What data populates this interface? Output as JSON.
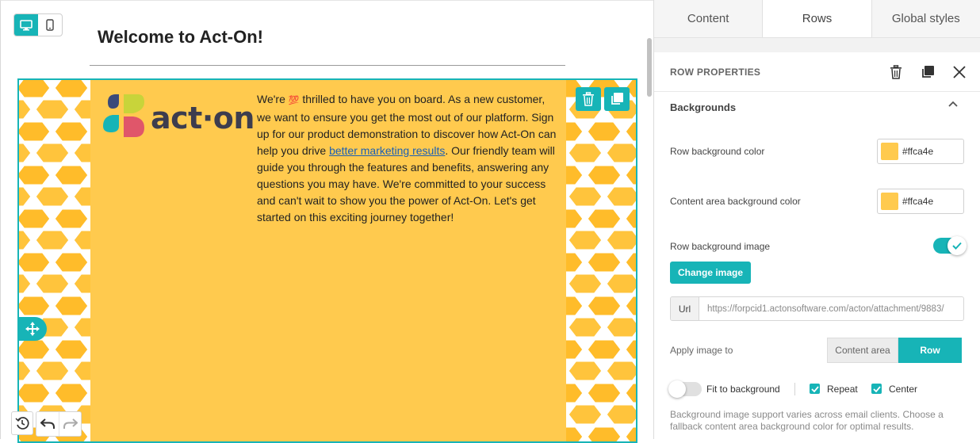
{
  "editor": {
    "heading": "Welcome to Act-On!",
    "logo_text": "act·on",
    "body_before_emoji": "We're ",
    "emoji": "💯",
    "body_part1": " thrilled to have you on board. As a new customer, we want to ensure you get the most out of our platform. Sign up for our product demonstration to discover how Act-On can help you drive ",
    "link_text": "better marketing results",
    "body_part2": ". Our friendly team will guide you through the features and benefits, answering any questions you may have. We're committed to your success and can't wait to show you the power of Act-On. Let's get started on this exciting journey together!"
  },
  "tabs": [
    "Content",
    "Rows",
    "Global styles"
  ],
  "panel": {
    "title": "ROW PROPERTIES",
    "section": "Backgrounds",
    "row_bg_label": "Row background color",
    "row_bg_value": "#ffca4e",
    "content_bg_label": "Content area background color",
    "content_bg_value": "#ffca4e",
    "bg_image_label": "Row background image",
    "change_image": "Change image",
    "url_prefix": "Url",
    "url_value": "https://forpcid1.actonsoftware.com/acton/attachment/9883/",
    "apply_label": "Apply image to",
    "apply_options": [
      "Content area",
      "Row"
    ],
    "fit_label": "Fit to background",
    "repeat_label": "Repeat",
    "center_label": "Center",
    "note": "Background image support varies across email clients. Choose a fallback content area background color for optimal results."
  },
  "colors": {
    "accent": "#17b4b7",
    "content_bg": "#ffca4e",
    "honeycomb": "#ffb81c"
  }
}
